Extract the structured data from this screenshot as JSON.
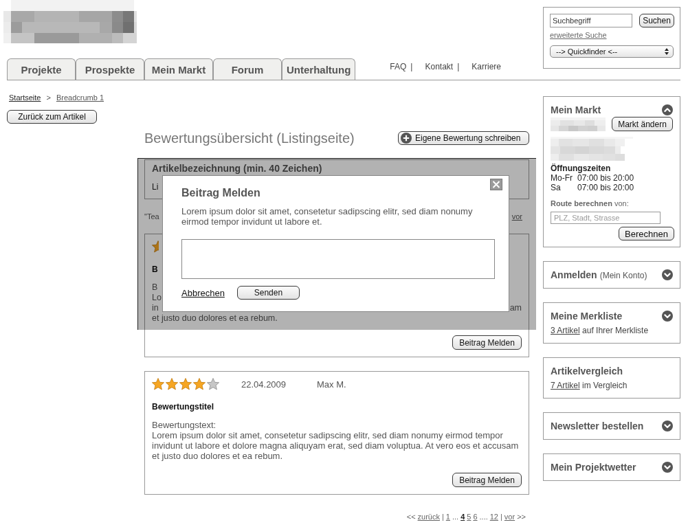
{
  "tabs": [
    {
      "label": "Projekte",
      "selected": false
    },
    {
      "label": "Prospekte",
      "selected": false
    },
    {
      "label": "Mein Markt",
      "selected": false
    },
    {
      "label": "Forum",
      "selected": false
    },
    {
      "label": "Unterhaltung",
      "selected": false
    }
  ],
  "top_links": [
    {
      "label": "FAQ",
      "separator": "|"
    },
    {
      "label": "Kontakt",
      "separator": "|"
    },
    {
      "label": "Karriere"
    }
  ],
  "search": {
    "value": "Suchbegriff",
    "button": "Suchen",
    "advanced_link": "erweiterte Suche",
    "quickfinder": "--> Quickfinder <--"
  },
  "breadcrumb": [
    {
      "label": "Startseite"
    },
    {
      "separator": ">",
      "label": "Breadcrumb 1"
    }
  ],
  "back_button": "Zurück zum Artikel",
  "page_title": "Bewertungsübersicht (Listingseite)",
  "write_review_button": "Eigene Bewertung schreiben",
  "article_card": {
    "title": "Artikelbezeichnung (min. 40 Zeichen)",
    "line": "Li"
  },
  "teaser": {
    "text": "\"Tea",
    "link": "vor"
  },
  "covered_review": {
    "star_filled": true,
    "title": "B",
    "lines": [
      {
        "left": "B"
      },
      {
        "left": "Lo"
      },
      {
        "left": "in",
        "right": "am"
      },
      {
        "left": "et justo duo dolores et ea rebum."
      }
    ],
    "report_button": "Beitrag Melden"
  },
  "dialog": {
    "title": "Beitrag Melden",
    "text": "Lorem ipsum dolor sit amet, consetetur sadipscing elitr, sed diam nonumy eirmod tempor invidunt ut labore et.",
    "cancel": "Abbrechen",
    "submit": "Senden"
  },
  "reviews": [
    {
      "stars": 4,
      "date": "22.04.2009",
      "author": "Max M.",
      "title": "Bewertungstitel",
      "text_label": "Bewertungstext:",
      "text": "Lorem ipsum dolor sit amet, consetetur sadipscing elitr, sed diam nonumy eirmod tempor invidunt ut labore et dolore magna aliquyam erat, sed diam voluptua. At vero eos et accusam et justo duo dolores et ea rebum.",
      "report_button": "Beitrag Melden"
    }
  ],
  "pagination": [
    {
      "kind": "text",
      "text": "<<"
    },
    {
      "kind": "link",
      "text": "zurück"
    },
    {
      "kind": "text",
      "text": "|"
    },
    {
      "kind": "page",
      "text": "1",
      "selected": false
    },
    {
      "kind": "text",
      "text": "..."
    },
    {
      "kind": "page",
      "text": "4",
      "selected": true
    },
    {
      "kind": "page",
      "text": "5",
      "selected": false
    },
    {
      "kind": "page",
      "text": "6",
      "selected": false
    },
    {
      "kind": "text",
      "text": "...."
    },
    {
      "kind": "page",
      "text": "12",
      "selected": false
    },
    {
      "kind": "text",
      "text": "|"
    },
    {
      "kind": "link",
      "text": "vor"
    },
    {
      "kind": "text",
      "text": ">>"
    }
  ],
  "sidebar": [
    {
      "kind": "market",
      "title": "Mein Markt",
      "expanded": true,
      "change_button": "Markt ändern",
      "hours_title": "Öffnungszeiten",
      "hours": [
        {
          "days": "Mo-Fr",
          "time": "07:00 bis 20:00"
        },
        {
          "days": "Sa",
          "time": "07:00 bis 20:00"
        }
      ],
      "route_label": "**Route berechnen** von:",
      "route_field": {
        "placeholder": "PLZ, Stadt, Strasse"
      },
      "route_button": "Berechnen"
    },
    {
      "kind": "toggle",
      "title": "Anmelden",
      "title_note": "(Mein Konto)",
      "expanded": false
    },
    {
      "kind": "toggle",
      "title": "Meine Merkliste",
      "expanded": false,
      "link": "3 Artikel",
      "text": "auf Ihrer Merkliste"
    },
    {
      "kind": "plain",
      "title": "Artikelvergleich",
      "link": "7 Artikel",
      "text": "im Vergleich"
    },
    {
      "kind": "toggle",
      "title": "Newsletter bestellen",
      "expanded": false
    },
    {
      "kind": "toggle",
      "title": "Mein Projektwetter",
      "expanded": false
    }
  ]
}
